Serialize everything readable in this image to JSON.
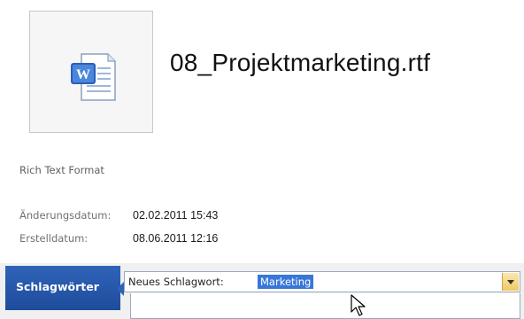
{
  "file": {
    "name": "08_Projektmarketing.rtf",
    "type_label": "Rich Text Format",
    "icon": "word-document-icon"
  },
  "details": [
    {
      "label": "Änderungsdatum:",
      "value": "02.02.2011 15:43"
    },
    {
      "label": "Erstelldatum:",
      "value": "08.06.2011 12:16"
    }
  ],
  "tags_panel": {
    "tab_label": "Schlagwörter",
    "field_label": "Neues Schlagwort:",
    "input_value": "Marketing",
    "dropdown_icon": "chevron-down-icon"
  },
  "colors": {
    "tab_blue": "#2f63b8",
    "selection_blue": "#3877d8",
    "dropdown_gold": "#f0c860"
  }
}
